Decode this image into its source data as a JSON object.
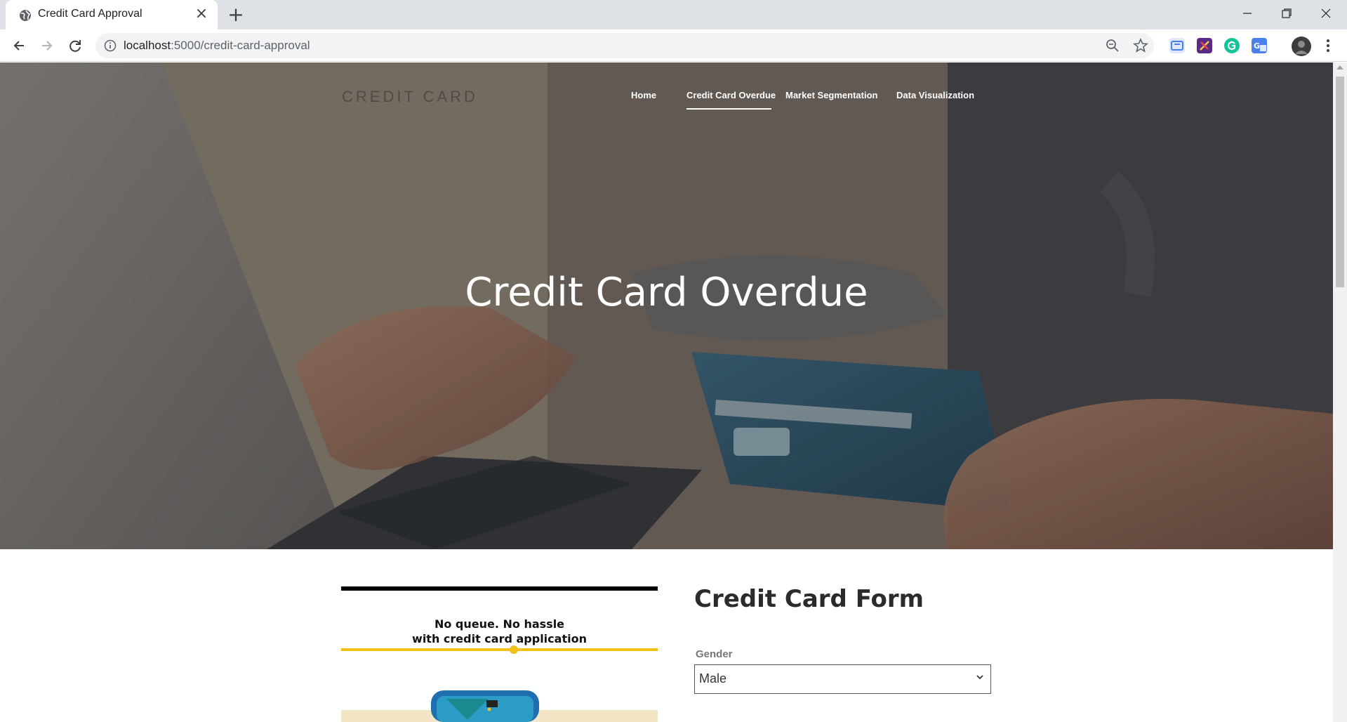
{
  "browser": {
    "tab_title": "Credit Card Approval",
    "url_host": "localhost",
    "url_path": ":5000/credit-card-approval"
  },
  "site": {
    "brand": "CREDIT CARD",
    "nav": [
      {
        "label": "Home"
      },
      {
        "label": "Credit Card Overdue"
      },
      {
        "label": "Market Segmentation"
      },
      {
        "label": "Data Visualization"
      }
    ],
    "hero_title": "Credit Card Overdue"
  },
  "illustration": {
    "line1": "No queue. No hassle",
    "line2": "with credit card application"
  },
  "form": {
    "title": "Credit Card Form",
    "gender_label": "Gender",
    "gender_value": "Male"
  },
  "colors": {
    "accent_yellow": "#f2c21b",
    "text_dark": "#2b2b2b"
  }
}
